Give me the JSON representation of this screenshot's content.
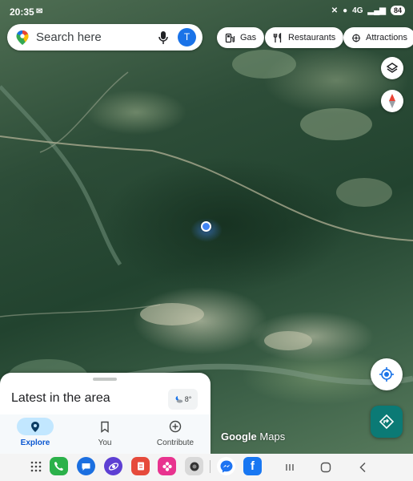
{
  "status_bar": {
    "time": "20:35",
    "battery": "84",
    "network": "4G"
  },
  "search": {
    "placeholder": "Search here",
    "avatar_initial": "T"
  },
  "chips": [
    {
      "label": "Gas",
      "icon": "gas-station-icon"
    },
    {
      "label": "Restaurants",
      "icon": "fork-knife-icon"
    },
    {
      "label": "Attractions",
      "icon": "attractions-icon"
    }
  ],
  "map_controls": [
    "layers-icon",
    "compass-icon",
    "my-location-icon",
    "directions-icon"
  ],
  "branding": {
    "google": "Google",
    "maps": "Maps"
  },
  "sheet": {
    "title": "Latest in the area",
    "weather": {
      "temp": "8°",
      "icon": "moon-cloud-icon"
    }
  },
  "bottom_nav": [
    {
      "label": "Explore",
      "icon": "explore-pin-icon",
      "active": true
    },
    {
      "label": "You",
      "icon": "bookmark-icon",
      "active": false
    },
    {
      "label": "Contribute",
      "icon": "add-circle-icon",
      "active": false
    }
  ],
  "dock_apps": [
    "app-drawer-icon",
    "phone-icon",
    "messages-icon",
    "browser-icon",
    "notes-icon",
    "gallery-icon",
    "camera-icon",
    "messenger-icon",
    "facebook-icon"
  ],
  "system_nav": [
    "recents-icon",
    "home-icon",
    "back-icon"
  ],
  "colors": {
    "accent": "#1a73e8",
    "directions": "#0b7a75",
    "nav_active_bg": "#c2e7ff"
  }
}
